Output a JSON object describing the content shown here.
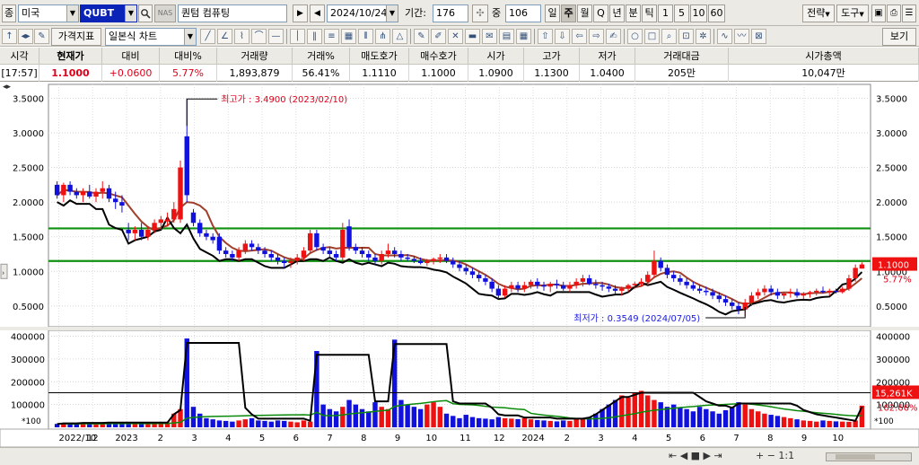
{
  "toolbar1": {
    "market_label": "종",
    "market_value": "미국",
    "ticker": "QUBT",
    "nasdaq_tag": "NAS",
    "stock_name": "퀀텀 컴퓨팅",
    "date": "2024/10/24",
    "period_label": "기간:",
    "period_value": "176",
    "zoom_label": "중",
    "zoom_value": "106",
    "intervals": [
      "일",
      "주",
      "월",
      "Q",
      "년",
      "분",
      "틱",
      "1",
      "5",
      "10",
      "60"
    ],
    "selected_interval": "주",
    "strategy": "전략",
    "tools": "도구"
  },
  "toolbar2": {
    "price_index": "가격지표",
    "chart_type": "일본식 차트",
    "view": "보기"
  },
  "quote": {
    "headers": [
      "시각",
      "현재가",
      "대비",
      "대비%",
      "거래량",
      "거래%",
      "매도호가",
      "매수호가",
      "시가",
      "고가",
      "저가",
      "거래대금",
      "시가총액"
    ],
    "values": [
      "[17:57]",
      "1.1000",
      "+0.0600",
      "5.77%",
      "1,893,879",
      "56.41%",
      "1.1110",
      "1.1000",
      "1.0900",
      "1.1300",
      "1.0400",
      "205만",
      "10,047만"
    ]
  },
  "chart_data": {
    "type": "candlestick",
    "price_axis": {
      "ticks": [
        "3.5000",
        "3.0000",
        "2.5000",
        "2.0000",
        "1.5000",
        "1.0000",
        "0.5000"
      ],
      "range": [
        0.2,
        3.7
      ]
    },
    "volume_axis": {
      "ticks": [
        "400000",
        "300000",
        "200000",
        "100000"
      ],
      "unit_label": "*100"
    },
    "x_labels": [
      "2022/10",
      "12",
      "2023",
      "2",
      "3",
      "4",
      "5",
      "6",
      "7",
      "8",
      "9",
      "10",
      "11",
      "12",
      "2024",
      "2",
      "3",
      "4",
      "5",
      "6",
      "7",
      "8",
      "9",
      "10"
    ],
    "annotations": {
      "high": "최고가 : 3.4900 (2023/02/10)",
      "low": "최저가 : 0.3549 (2024/07/05)"
    },
    "current_price_tag": "1.1000",
    "change_pct_tag": "5.77%",
    "volume_tag": "15,261K",
    "volume_pct_tag": "162.66%",
    "horizontal_lines": [
      1.62,
      1.15
    ],
    "colors": {
      "up": "#ee1111",
      "down": "#1111dd",
      "ma": "#a0402c",
      "black_line": "#000000",
      "volume_ma": "#0a8a0a",
      "hline": "#109010"
    },
    "candles": [
      [
        2.25,
        2.3,
        2.05,
        2.1
      ],
      [
        2.1,
        2.28,
        2.0,
        2.25
      ],
      [
        2.25,
        2.3,
        2.1,
        2.15
      ],
      [
        2.15,
        2.2,
        2.05,
        2.1
      ],
      [
        2.1,
        2.2,
        2.0,
        2.15
      ],
      [
        2.15,
        2.25,
        2.05,
        2.08
      ],
      [
        2.08,
        2.2,
        2.0,
        2.15
      ],
      [
        2.15,
        2.3,
        2.05,
        2.2
      ],
      [
        2.2,
        2.25,
        2.0,
        2.05
      ],
      [
        2.05,
        2.15,
        1.9,
        2.0
      ],
      [
        2.0,
        2.1,
        1.85,
        1.95
      ],
      [
        1.6,
        1.7,
        1.45,
        1.55
      ],
      [
        1.55,
        1.65,
        1.45,
        1.6
      ],
      [
        1.6,
        1.7,
        1.45,
        1.5
      ],
      [
        1.5,
        1.65,
        1.45,
        1.6
      ],
      [
        1.6,
        1.75,
        1.55,
        1.7
      ],
      [
        1.7,
        1.8,
        1.6,
        1.75
      ],
      [
        1.72,
        1.85,
        1.65,
        1.75
      ],
      [
        1.75,
        2.0,
        1.7,
        1.9
      ],
      [
        1.75,
        2.6,
        1.7,
        2.5
      ],
      [
        2.95,
        3.49,
        2.0,
        2.1
      ],
      [
        1.85,
        1.9,
        1.65,
        1.7
      ],
      [
        1.7,
        1.75,
        1.5,
        1.55
      ],
      [
        1.55,
        1.6,
        1.45,
        1.5
      ],
      [
        1.5,
        1.55,
        1.4,
        1.45
      ],
      [
        1.5,
        1.55,
        1.25,
        1.3
      ],
      [
        1.3,
        1.35,
        1.2,
        1.25
      ],
      [
        1.25,
        1.3,
        1.15,
        1.2
      ],
      [
        1.2,
        1.35,
        1.15,
        1.3
      ],
      [
        1.3,
        1.45,
        1.25,
        1.4
      ],
      [
        1.4,
        1.45,
        1.3,
        1.35
      ],
      [
        1.35,
        1.4,
        1.25,
        1.3
      ],
      [
        1.3,
        1.35,
        1.2,
        1.25
      ],
      [
        1.25,
        1.3,
        1.15,
        1.2
      ],
      [
        1.2,
        1.25,
        1.1,
        1.15
      ],
      [
        1.15,
        1.2,
        1.05,
        1.12
      ],
      [
        1.12,
        1.2,
        1.05,
        1.15
      ],
      [
        1.15,
        1.25,
        1.1,
        1.2
      ],
      [
        1.2,
        1.35,
        1.15,
        1.3
      ],
      [
        1.3,
        1.6,
        1.25,
        1.55
      ],
      [
        1.55,
        1.6,
        1.3,
        1.35
      ],
      [
        1.35,
        1.4,
        1.25,
        1.3
      ],
      [
        1.3,
        1.35,
        1.2,
        1.25
      ],
      [
        1.25,
        1.3,
        1.15,
        1.2
      ],
      [
        1.2,
        1.7,
        1.15,
        1.6
      ],
      [
        1.65,
        1.75,
        1.3,
        1.35
      ],
      [
        1.35,
        1.4,
        1.25,
        1.3
      ],
      [
        1.3,
        1.35,
        1.2,
        1.25
      ],
      [
        1.25,
        1.3,
        1.15,
        1.2
      ],
      [
        1.2,
        1.25,
        1.1,
        1.15
      ],
      [
        1.15,
        1.3,
        1.1,
        1.25
      ],
      [
        1.25,
        1.4,
        1.2,
        1.3
      ],
      [
        1.3,
        1.35,
        1.2,
        1.25
      ],
      [
        1.25,
        1.3,
        1.15,
        1.2
      ],
      [
        1.2,
        1.25,
        1.15,
        1.18
      ],
      [
        1.18,
        1.22,
        1.12,
        1.15
      ],
      [
        1.15,
        1.2,
        1.1,
        1.12
      ],
      [
        1.12,
        1.18,
        1.08,
        1.15
      ],
      [
        1.15,
        1.2,
        1.1,
        1.18
      ],
      [
        1.18,
        1.25,
        1.12,
        1.2
      ],
      [
        1.2,
        1.25,
        1.12,
        1.15
      ],
      [
        1.15,
        1.2,
        1.05,
        1.1
      ],
      [
        1.1,
        1.15,
        1.0,
        1.05
      ],
      [
        1.05,
        1.1,
        0.95,
        1.0
      ],
      [
        1.0,
        1.05,
        0.9,
        0.95
      ],
      [
        0.95,
        1.0,
        0.85,
        0.9
      ],
      [
        0.9,
        0.95,
        0.8,
        0.85
      ],
      [
        0.85,
        0.9,
        0.7,
        0.75
      ],
      [
        0.75,
        0.8,
        0.6,
        0.65
      ],
      [
        0.65,
        0.8,
        0.62,
        0.75
      ],
      [
        0.75,
        0.85,
        0.7,
        0.8
      ],
      [
        0.8,
        0.85,
        0.7,
        0.75
      ],
      [
        0.75,
        0.85,
        0.7,
        0.8
      ],
      [
        0.8,
        0.88,
        0.75,
        0.85
      ],
      [
        0.85,
        0.9,
        0.75,
        0.8
      ],
      [
        0.8,
        0.85,
        0.72,
        0.78
      ],
      [
        0.78,
        0.85,
        0.7,
        0.82
      ],
      [
        0.82,
        0.88,
        0.75,
        0.8
      ],
      [
        0.8,
        0.85,
        0.72,
        0.75
      ],
      [
        0.75,
        0.85,
        0.7,
        0.8
      ],
      [
        0.8,
        0.9,
        0.75,
        0.85
      ],
      [
        0.85,
        0.95,
        0.78,
        0.9
      ],
      [
        0.9,
        0.95,
        0.8,
        0.82
      ],
      [
        0.82,
        0.88,
        0.75,
        0.8
      ],
      [
        0.8,
        0.85,
        0.72,
        0.78
      ],
      [
        0.78,
        0.82,
        0.7,
        0.75
      ],
      [
        0.75,
        0.8,
        0.68,
        0.72
      ],
      [
        0.72,
        0.78,
        0.65,
        0.75
      ],
      [
        0.75,
        0.82,
        0.7,
        0.8
      ],
      [
        0.8,
        0.85,
        0.75,
        0.82
      ],
      [
        0.82,
        0.9,
        0.78,
        0.85
      ],
      [
        0.85,
        1.0,
        0.8,
        0.95
      ],
      [
        0.95,
        1.3,
        0.9,
        1.15
      ],
      [
        1.15,
        1.2,
        1.0,
        1.05
      ],
      [
        1.05,
        1.1,
        0.9,
        0.95
      ],
      [
        0.95,
        1.0,
        0.85,
        0.9
      ],
      [
        0.9,
        0.95,
        0.8,
        0.85
      ],
      [
        0.85,
        0.9,
        0.75,
        0.8
      ],
      [
        0.8,
        0.85,
        0.72,
        0.75
      ],
      [
        0.75,
        0.8,
        0.68,
        0.72
      ],
      [
        0.72,
        0.78,
        0.65,
        0.7
      ],
      [
        0.7,
        0.75,
        0.6,
        0.65
      ],
      [
        0.65,
        0.7,
        0.55,
        0.6
      ],
      [
        0.6,
        0.65,
        0.5,
        0.55
      ],
      [
        0.55,
        0.6,
        0.45,
        0.5
      ],
      [
        0.5,
        0.55,
        0.38,
        0.45
      ],
      [
        0.45,
        0.6,
        0.355,
        0.55
      ],
      [
        0.55,
        0.7,
        0.5,
        0.65
      ],
      [
        0.65,
        0.75,
        0.6,
        0.7
      ],
      [
        0.7,
        0.8,
        0.65,
        0.75
      ],
      [
        0.75,
        0.8,
        0.65,
        0.7
      ],
      [
        0.7,
        0.75,
        0.6,
        0.65
      ],
      [
        0.65,
        0.7,
        0.6,
        0.68
      ],
      [
        0.68,
        0.75,
        0.62,
        0.7
      ],
      [
        0.7,
        0.75,
        0.62,
        0.65
      ],
      [
        0.65,
        0.7,
        0.6,
        0.68
      ],
      [
        0.68,
        0.72,
        0.62,
        0.7
      ],
      [
        0.7,
        0.75,
        0.65,
        0.72
      ],
      [
        0.72,
        0.78,
        0.68,
        0.7
      ],
      [
        0.7,
        0.75,
        0.65,
        0.72
      ],
      [
        0.72,
        0.75,
        0.68,
        0.7
      ],
      [
        0.7,
        0.78,
        0.68,
        0.75
      ],
      [
        0.75,
        0.95,
        0.72,
        0.9
      ],
      [
        0.9,
        1.1,
        0.85,
        1.05
      ],
      [
        1.04,
        1.13,
        1.04,
        1.1
      ]
    ],
    "volumes": [
      15,
      18,
      12,
      14,
      20,
      16,
      13,
      15,
      22,
      18,
      17,
      19,
      14,
      16,
      18,
      15,
      20,
      22,
      60,
      80,
      390,
      90,
      60,
      40,
      35,
      30,
      28,
      25,
      30,
      35,
      40,
      30,
      28,
      25,
      30,
      28,
      25,
      22,
      30,
      25,
      335,
      100,
      80,
      70,
      90,
      120,
      100,
      80,
      70,
      110,
      90,
      80,
      385,
      120,
      100,
      90,
      80,
      100,
      110,
      90,
      60,
      50,
      40,
      55,
      45,
      40,
      38,
      35,
      45,
      40,
      38,
      36,
      40,
      35,
      32,
      30,
      28,
      26,
      30,
      28,
      35,
      40,
      45,
      60,
      80,
      100,
      120,
      140,
      130,
      150,
      160,
      140,
      120,
      110,
      90,
      100,
      85,
      80,
      70,
      90,
      80,
      70,
      60,
      75,
      90,
      110,
      100,
      80,
      70,
      60,
      55,
      50,
      45,
      40,
      35,
      30,
      28,
      25,
      30,
      28,
      26,
      25,
      24,
      30,
      95,
      152
    ]
  }
}
